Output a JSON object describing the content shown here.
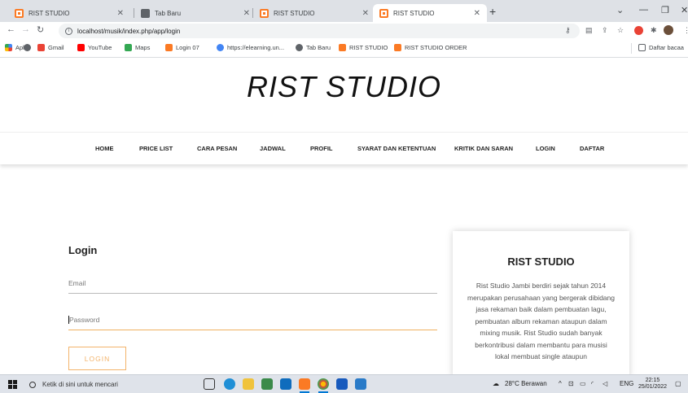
{
  "browser": {
    "tabs": [
      {
        "title": "RIST STUDIO",
        "icon": "xampp-icon",
        "active": false
      },
      {
        "title": "Tab Baru",
        "icon": "globe-icon",
        "active": false
      },
      {
        "title": "RIST STUDIO",
        "icon": "xampp-icon",
        "active": false
      },
      {
        "title": "RIST STUDIO",
        "icon": "xampp-icon",
        "active": true
      }
    ],
    "new_tab": "+",
    "address": "localhost/musik/index.php/app/login",
    "bookmarks": [
      {
        "label": "Apl",
        "icon": "apps-grid-icon"
      },
      {
        "label": "",
        "icon": "globe-icon"
      },
      {
        "label": "Gmail",
        "icon": "gmail-icon"
      },
      {
        "label": "YouTube",
        "icon": "youtube-icon"
      },
      {
        "label": "Maps",
        "icon": "maps-icon"
      },
      {
        "label": "Login 07",
        "icon": "xampp-icon"
      },
      {
        "label": "https://elearning.un...",
        "icon": "google-icon"
      },
      {
        "label": "Tab Baru",
        "icon": "globe-icon"
      },
      {
        "label": "RIST STUDIO",
        "icon": "xampp-icon"
      },
      {
        "label": "RIST STUDIO ORDER",
        "icon": "xampp-icon"
      }
    ],
    "reading_list": "Daftar bacaa"
  },
  "site": {
    "brand": "RIST STUDIO",
    "nav": [
      "HOME",
      "PRICE LIST",
      "CARA PESAN",
      "JADWAL",
      "PROFIL",
      "SYARAT DAN KETENTUAN",
      "KRITIK DAN SARAN",
      "LOGIN",
      "DAFTAR"
    ],
    "login": {
      "title": "Login",
      "email_placeholder": "Email",
      "password_placeholder": "Password",
      "button": "LOGIN"
    },
    "card": {
      "title": "RIST STUDIO",
      "text": "Rist Studio Jambi berdiri sejak tahun 2014 merupakan perusahaan yang bergerak dibidang jasa rekaman baik dalam pembuatan lagu, pembuatan album rekaman ataupun dalam mixing musik. Rist Studio sudah banyak berkontribusi dalam membantu para musisi lokal membuat single ataupun"
    }
  },
  "taskbar": {
    "search_placeholder": "Ketik di sini untuk mencari",
    "weather": "28°C  Berawan",
    "language": "ENG",
    "time": "22:15",
    "date": "25/01/2022"
  },
  "colors": {
    "accent": "#f3b36a",
    "tabstrip": "#dee1e6",
    "taskbar": "#dfe3ea"
  }
}
